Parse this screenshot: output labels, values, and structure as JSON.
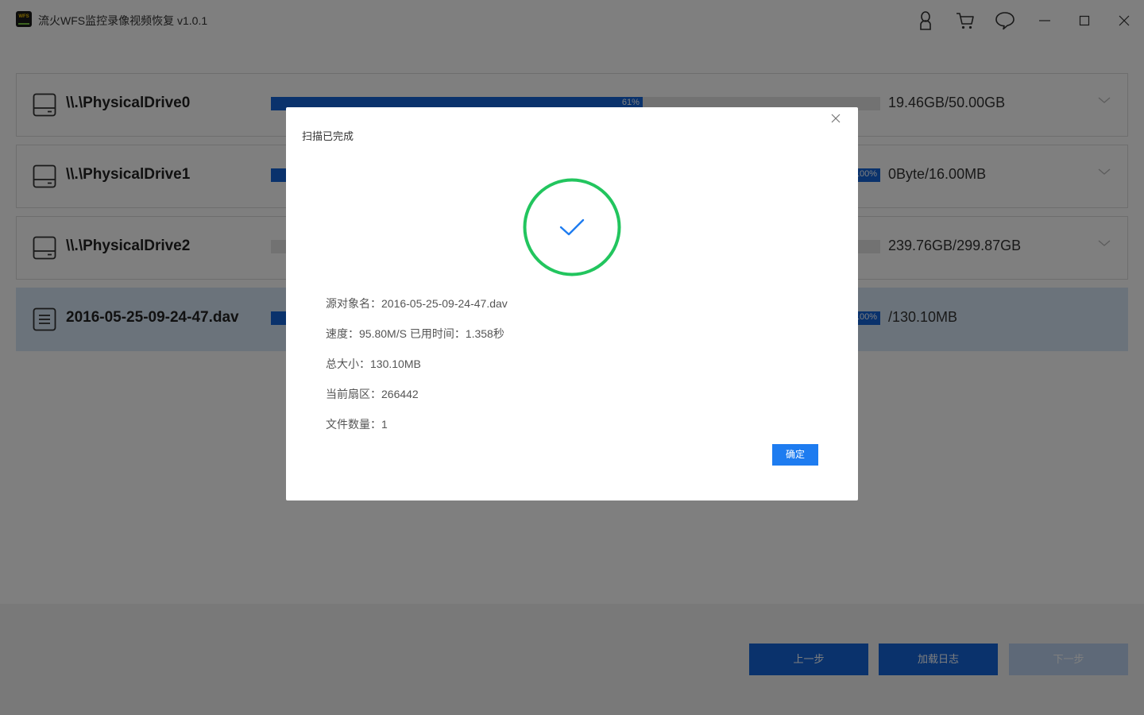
{
  "app": {
    "logo_text": "WFS",
    "title": "流火WFS监控录像视频恢复 v1.0.1"
  },
  "titlebar_icons": [
    "user-icon",
    "cart-icon",
    "chat-icon",
    "minimize-icon",
    "maximize-icon",
    "close-icon"
  ],
  "drives": [
    {
      "name": "\\\\.\\PhysicalDrive0",
      "icon": "hard-drive-icon",
      "progress_label": "61%",
      "progress": 0.61,
      "size": "19.46GB/50.00GB",
      "selected": false
    },
    {
      "name": "\\\\.\\PhysicalDrive1",
      "icon": "hard-drive-icon",
      "progress_label": "100%",
      "progress": 1.0,
      "size": "0Byte/16.00MB",
      "selected": false
    },
    {
      "name": "\\\\.\\PhysicalDrive2",
      "icon": "hard-drive-icon",
      "progress_label": "",
      "progress": 0.0,
      "size": "239.76GB/299.87GB",
      "selected": false
    },
    {
      "name": "2016-05-25-09-24-47.dav",
      "icon": "file-icon",
      "progress_label": "100%",
      "progress": 1.0,
      "size": "/130.10MB",
      "selected": true
    }
  ],
  "footer": {
    "prev_label": "上一步",
    "log_label": "加载日志",
    "next_label": "下一步"
  },
  "dialog": {
    "title": "扫描已完成",
    "source": "源对象名：2016-05-25-09-24-47.dav",
    "speed": "速度：95.80M/S 已用时间：1.358秒",
    "total_size": "总大小：130.10MB",
    "current_sector": "当前扇区：266442",
    "file_count": "文件数量：1",
    "ok_label": "确定"
  },
  "colors": {
    "accent": "#1565d8",
    "success": "#22c55e",
    "check": "#1e7cf0",
    "selected_row": "#d6e6f7"
  }
}
